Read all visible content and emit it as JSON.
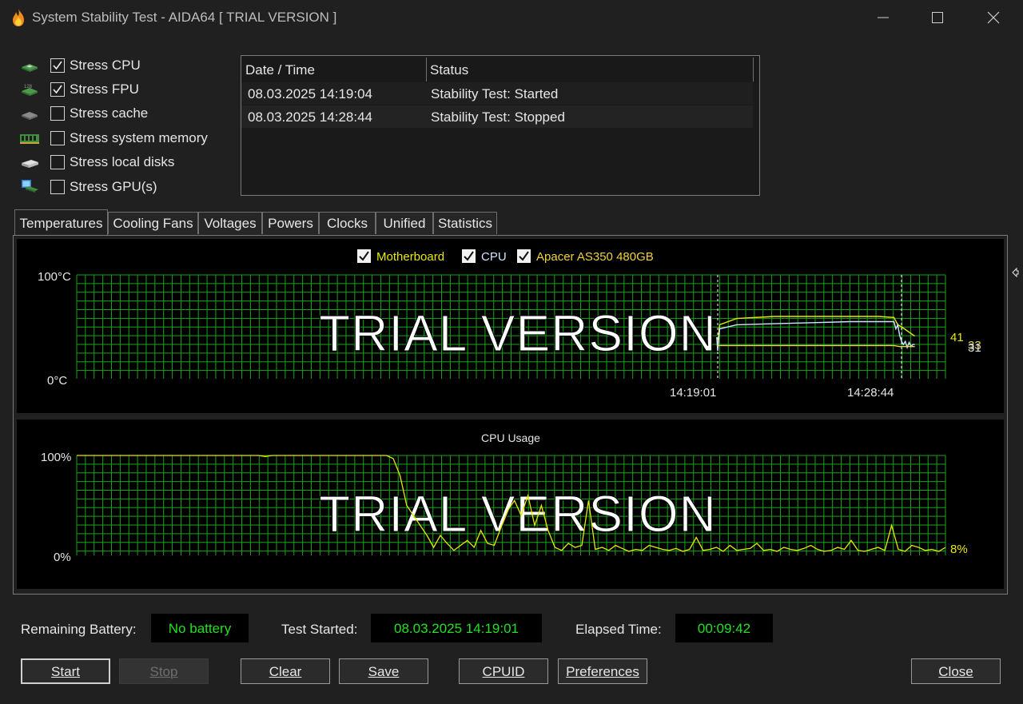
{
  "window": {
    "title": "System Stability Test - AIDA64  [ TRIAL VERSION ]"
  },
  "stress_options": [
    {
      "label": "Stress CPU",
      "checked": true,
      "icon": "cpu-chip-icon"
    },
    {
      "label": "Stress FPU",
      "checked": true,
      "icon": "fpu-chip-icon"
    },
    {
      "label": "Stress cache",
      "checked": false,
      "icon": "cache-chip-icon"
    },
    {
      "label": "Stress system memory",
      "checked": false,
      "icon": "memory-module-icon"
    },
    {
      "label": "Stress local disks",
      "checked": false,
      "icon": "disk-drive-icon"
    },
    {
      "label": "Stress GPU(s)",
      "checked": false,
      "icon": "gpu-monitor-icon"
    }
  ],
  "log": {
    "columns": [
      "Date / Time",
      "Status"
    ],
    "rows": [
      {
        "datetime": "08.03.2025 14:19:04",
        "status": "Stability Test: Started"
      },
      {
        "datetime": "08.03.2025 14:28:44",
        "status": "Stability Test: Stopped"
      }
    ]
  },
  "tabs": [
    {
      "label": "Temperatures",
      "active": true
    },
    {
      "label": "Cooling Fans",
      "active": false
    },
    {
      "label": "Voltages",
      "active": false
    },
    {
      "label": "Powers",
      "active": false
    },
    {
      "label": "Clocks",
      "active": false
    },
    {
      "label": "Unified",
      "active": false
    },
    {
      "label": "Statistics",
      "active": false
    }
  ],
  "watermark": "TRIAL VERSION",
  "temperature_legend": [
    {
      "label": "Motherboard",
      "color": "#e8e800"
    },
    {
      "label": "CPU",
      "color": "#cfe6ff"
    },
    {
      "label": "Apacer AS350 480GB",
      "color": "#f0d23c"
    }
  ],
  "bottom": {
    "battery_label": "Remaining Battery:",
    "battery_value": "No battery",
    "started_label": "Test Started:",
    "started_value": "08.03.2025 14:19:01",
    "elapsed_label": "Elapsed Time:",
    "elapsed_value": "00:09:42"
  },
  "buttons": {
    "start": "Start",
    "stop": "Stop",
    "clear": "Clear",
    "save": "Save",
    "cpuid": "CPUID",
    "preferences": "Preferences",
    "close": "Close"
  },
  "chart_data": [
    {
      "type": "line",
      "title": "",
      "ylabel_top": "100°C",
      "ylabel_bottom": "0°C",
      "ylim": [
        0,
        100
      ],
      "grid": true,
      "legend": "top-center",
      "markers": [
        "14:19:01",
        "14:28:44"
      ],
      "current_value_labels": [
        "41",
        "33",
        "31"
      ],
      "series": [
        {
          "name": "Motherboard",
          "color": "#e8e800",
          "points": [
            [
              0,
              33
            ],
            [
              0.1,
              52
            ],
            [
              1,
              58
            ],
            [
              3,
              60
            ],
            [
              5,
              60
            ],
            [
              7,
              60
            ],
            [
              8.5,
              60
            ],
            [
              9.3,
              59
            ],
            [
              9.5,
              52
            ],
            [
              9.7,
              50
            ],
            [
              10.4,
              41
            ]
          ]
        },
        {
          "name": "CPU",
          "color": "#cfe6ff",
          "points": [
            [
              -0.05,
              40
            ],
            [
              0,
              27
            ],
            [
              0.1,
              48
            ],
            [
              1,
              52
            ],
            [
              3,
              53
            ],
            [
              5,
              54
            ],
            [
              7,
              55
            ],
            [
              8.5,
              55
            ],
            [
              9.3,
              55
            ],
            [
              9.4,
              48
            ],
            [
              9.5,
              52
            ],
            [
              9.6,
              42
            ],
            [
              9.7,
              36
            ],
            [
              9.8,
              33
            ],
            [
              9.9,
              36
            ],
            [
              10.0,
              30
            ],
            [
              10.1,
              35
            ],
            [
              10.2,
              31
            ],
            [
              10.3,
              33
            ],
            [
              10.4,
              33
            ]
          ]
        },
        {
          "name": "Apacer AS350 480GB",
          "color": "#f0d23c",
          "points": [
            [
              0,
              32
            ],
            [
              2,
              32
            ],
            [
              4,
              32
            ],
            [
              6,
              32
            ],
            [
              8,
              32
            ],
            [
              9.3,
              32
            ],
            [
              9.6,
              31
            ],
            [
              10.4,
              31
            ]
          ]
        }
      ]
    },
    {
      "type": "line",
      "title": "CPU Usage",
      "ylabel_top": "100%",
      "ylabel_bottom": "0%",
      "ylim": [
        0,
        100
      ],
      "grid": true,
      "current_value_label": "8%",
      "series": [
        {
          "name": "CPU Usage",
          "color": "#e8e800",
          "values": [
            100,
            100,
            100,
            100,
            100,
            100,
            100,
            100,
            100,
            100,
            100,
            100,
            100,
            100,
            100,
            100,
            100,
            100,
            100,
            100,
            100,
            100,
            100,
            100,
            100,
            100,
            100,
            100,
            99,
            100,
            100,
            100,
            100,
            100,
            100,
            100,
            100,
            100,
            100,
            100,
            100,
            100,
            100,
            100,
            100,
            100,
            100,
            97,
            80,
            50,
            40,
            30,
            20,
            8,
            20,
            12,
            5,
            10,
            15,
            8,
            25,
            12,
            10,
            28,
            45,
            55,
            40,
            60,
            30,
            50,
            25,
            8,
            5,
            12,
            8,
            10,
            55,
            6,
            8,
            5,
            10,
            7,
            4,
            6,
            5,
            10,
            8,
            6,
            5,
            7,
            4,
            6,
            18,
            5,
            6,
            8,
            4,
            10,
            5,
            6,
            7,
            12,
            5,
            6,
            4,
            8,
            6,
            5,
            7,
            10,
            6,
            4,
            5,
            8,
            6,
            15,
            5,
            4,
            6,
            8,
            5,
            30,
            6,
            4,
            10,
            8,
            5,
            6,
            4,
            8
          ]
        }
      ]
    }
  ]
}
